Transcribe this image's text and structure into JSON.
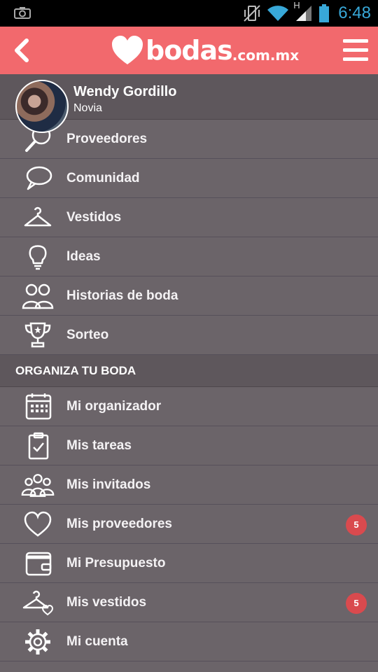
{
  "status_bar": {
    "time": "6:48",
    "network": "H",
    "icons": [
      "camera-icon",
      "vibrate-icon",
      "wifi-icon",
      "signal-icon",
      "battery-icon"
    ],
    "time_color": "#38a8d8"
  },
  "header": {
    "logo_text": "bodas",
    "logo_suffix": ".com.mx",
    "back_icon": "chevron-left-icon",
    "menu_icon": "hamburger-menu-icon",
    "color": "#f2696d"
  },
  "profile": {
    "name": "Wendy Gordillo",
    "role": "Novia"
  },
  "menu": [
    {
      "label": "Proveedores",
      "icon": "search-icon"
    },
    {
      "label": "Comunidad",
      "icon": "chat-bubble-icon"
    },
    {
      "label": "Vestidos",
      "icon": "hanger-icon"
    },
    {
      "label": "Ideas",
      "icon": "lightbulb-icon"
    },
    {
      "label": "Historias de boda",
      "icon": "couple-icon"
    },
    {
      "label": "Sorteo",
      "icon": "trophy-icon"
    }
  ],
  "section_title": "ORGANIZA TU BODA",
  "organizer": [
    {
      "label": "Mi organizador",
      "icon": "calendar-icon"
    },
    {
      "label": "Mis tareas",
      "icon": "clipboard-check-icon"
    },
    {
      "label": "Mis invitados",
      "icon": "guests-icon"
    },
    {
      "label": "Mis proveedores",
      "icon": "heart-icon",
      "badge": "5"
    },
    {
      "label": "Mi Presupuesto",
      "icon": "wallet-icon"
    },
    {
      "label": "Mis vestidos",
      "icon": "hanger-heart-icon",
      "badge": "5"
    },
    {
      "label": "Mi cuenta",
      "icon": "gear-icon"
    }
  ],
  "colors": {
    "menu_bg": "#6b6469",
    "badge": "#d94a4e"
  }
}
